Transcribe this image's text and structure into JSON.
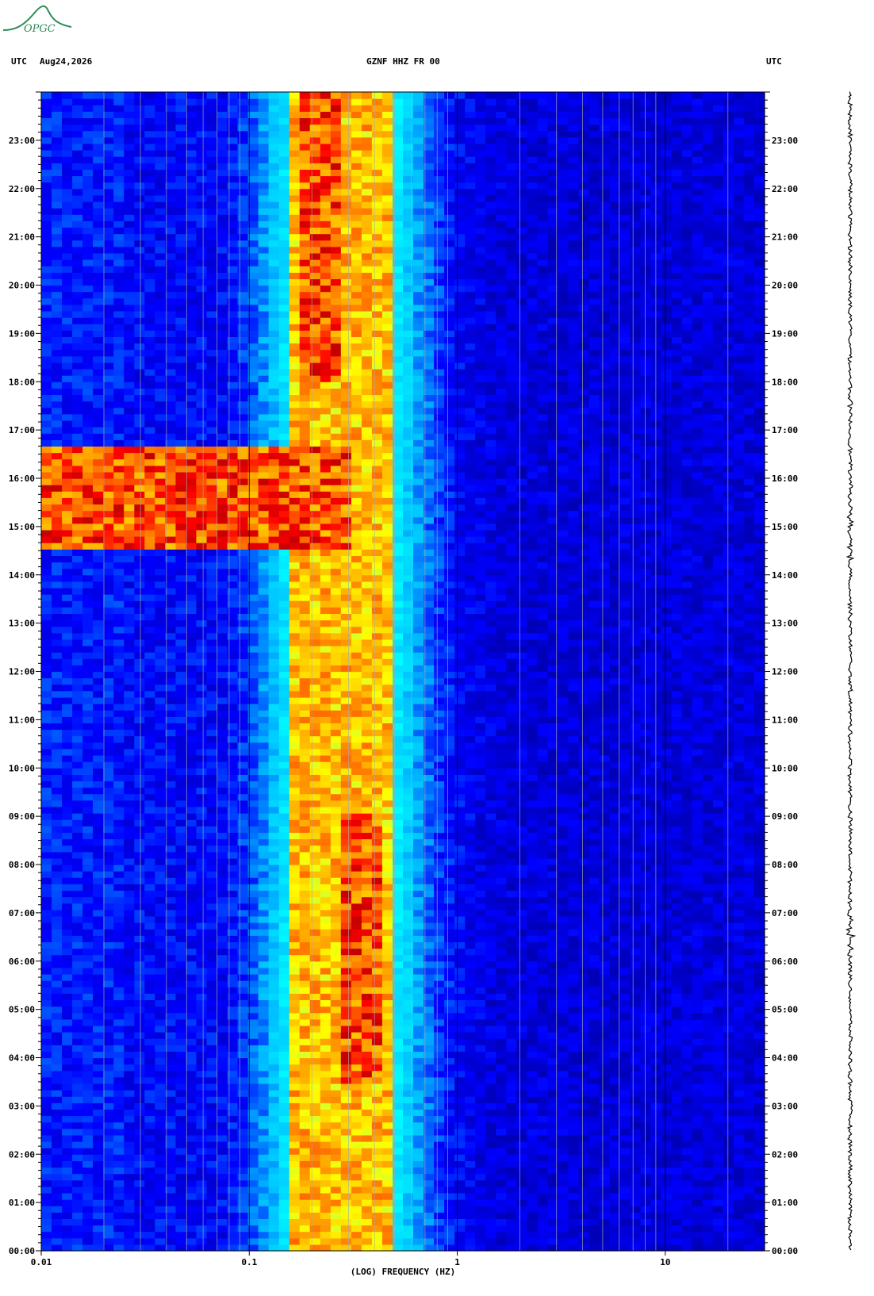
{
  "logo": {
    "text": "OPGC",
    "color": "#2e8b57"
  },
  "header": {
    "left_utc": "UTC",
    "date": "Aug24,2026",
    "station": "GZNF HHZ FR 00",
    "right_utc": "UTC"
  },
  "chart_data": {
    "type": "heatmap",
    "title": "GZNF HHZ FR 00",
    "xlabel": "(LOG) FREQUENCY (HZ)",
    "x_scale": "log",
    "xlim": [
      0.01,
      30
    ],
    "x_ticks": [
      {
        "value": 0.01,
        "label": "0.01"
      },
      {
        "value": 0.1,
        "label": "0.1"
      },
      {
        "value": 1,
        "label": "1"
      },
      {
        "value": 10,
        "label": "10"
      }
    ],
    "ylabel_left": "UTC",
    "ylabel_right": "UTC",
    "ylim_hours": [
      0,
      24
    ],
    "y_ticks": [
      "00:00",
      "01:00",
      "02:00",
      "03:00",
      "04:00",
      "05:00",
      "06:00",
      "07:00",
      "08:00",
      "09:00",
      "10:00",
      "11:00",
      "12:00",
      "13:00",
      "14:00",
      "15:00",
      "16:00",
      "17:00",
      "18:00",
      "19:00",
      "20:00",
      "21:00",
      "22:00",
      "23:00"
    ],
    "colormap": [
      "#00008b",
      "#0000ff",
      "#00bfff",
      "#00ffff",
      "#ffff00",
      "#ff8c00",
      "#ff0000",
      "#8b0000"
    ],
    "features": [
      {
        "name": "microseism band",
        "freq_range_hz": [
          0.15,
          0.5
        ],
        "time_range_h": [
          0,
          24
        ],
        "level": "high"
      },
      {
        "name": "strong microseism",
        "freq_range_hz": [
          0.28,
          0.42
        ],
        "time_range_h": [
          3.5,
          9
        ],
        "level": "very high"
      },
      {
        "name": "microseism peak",
        "freq_range_hz": [
          0.18,
          0.27
        ],
        "time_range_h": [
          18,
          24
        ],
        "level": "very high"
      },
      {
        "name": "low-frequency event",
        "freq_range_hz": [
          0.01,
          0.3
        ],
        "time_range_h": [
          14.5,
          16.6
        ],
        "level": "very high"
      }
    ]
  }
}
